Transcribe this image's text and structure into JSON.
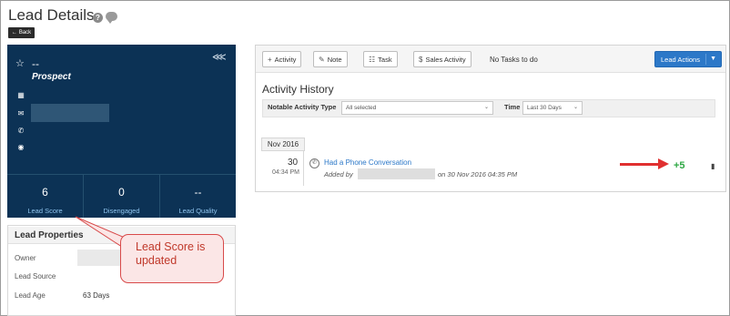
{
  "header": {
    "title": "Lead Details",
    "back_label": "Back",
    "help_glyph": "?"
  },
  "lead": {
    "name": "--",
    "stage": "Prospect",
    "icons": [
      "star-icon",
      "share-icon",
      "building-icon",
      "email-icon",
      "phone-icon",
      "location-icon"
    ],
    "stats": [
      {
        "value": "6",
        "label": "Lead Score"
      },
      {
        "value": "0",
        "label": "Disengaged"
      },
      {
        "value": "--",
        "label": "Lead Quality"
      }
    ]
  },
  "properties": {
    "title": "Lead Properties",
    "owner_label": "Owner",
    "source_label": "Lead Source",
    "age_label": "Lead Age",
    "age_value": "63 Days"
  },
  "callout": {
    "text": "Lead Score is updated"
  },
  "toolbar": {
    "activity": "Activity",
    "note": "Note",
    "task": "Task",
    "sales_activity": "Sales Activity",
    "no_tasks": "No Tasks to do",
    "lead_actions": "Lead Actions"
  },
  "history": {
    "title": "Activity History",
    "filter_type_label": "Notable Activity Type",
    "filter_type_value": "All selected",
    "time_label": "Time",
    "time_value": "Last 30 Days",
    "month": "Nov 2016",
    "item": {
      "day": "30",
      "time": "04:34 PM",
      "title": "Had a Phone Conversation",
      "added_by_prefix": "Added by",
      "added_on": "on 30 Nov 2016 04:35 PM",
      "score_delta": "+5"
    }
  },
  "colors": {
    "card_bg": "#0c3255",
    "accent_blue": "#2c78c8",
    "score_green": "#2ea844",
    "annotation_red": "#e03030"
  }
}
